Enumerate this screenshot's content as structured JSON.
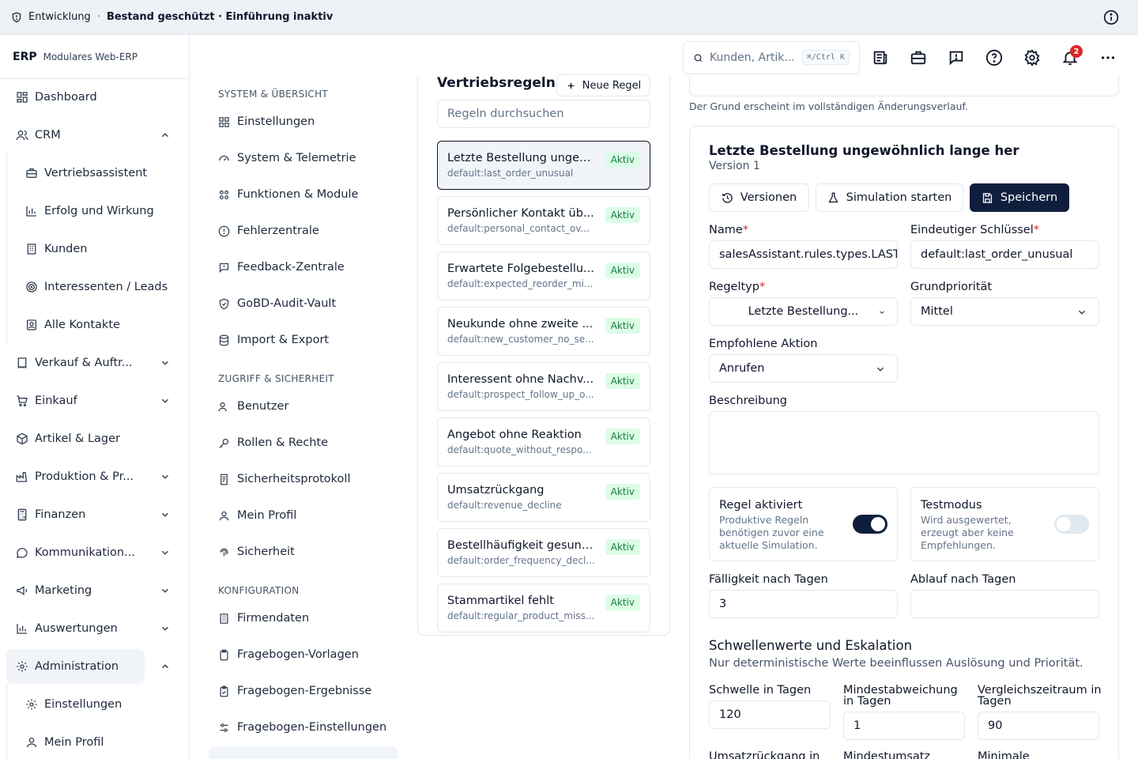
{
  "topbar": {
    "environment": "Entwicklung",
    "separator": "·",
    "status": "Bestand geschützt · Einführung inaktiv"
  },
  "brand": {
    "logo": "ERP",
    "subtitle": "Modulares Web-ERP"
  },
  "sidebar": {
    "items": [
      {
        "label": "Dashboard",
        "icon": "dashboard-icon"
      },
      {
        "label": "CRM",
        "icon": "users-icon",
        "expanded": true
      },
      {
        "label": "Vertriebsassistent",
        "icon": "briefcase-icon"
      },
      {
        "label": "Erfolg und Wirkung",
        "icon": "chart-icon"
      },
      {
        "label": "Kunden",
        "icon": "building-icon"
      },
      {
        "label": "Interessenten / Leads",
        "icon": "target-icon"
      },
      {
        "label": "Alle Kontakte",
        "icon": "contact-icon"
      },
      {
        "label": "Verkauf & Auftr...",
        "icon": "cart-icon"
      },
      {
        "label": "Einkauf",
        "icon": "cart-icon"
      },
      {
        "label": "Artikel & Lager",
        "icon": "box-icon"
      },
      {
        "label": "Produktion & Pr...",
        "icon": "factory-icon"
      },
      {
        "label": "Finanzen",
        "icon": "calculator-icon"
      },
      {
        "label": "Kommunikation...",
        "icon": "message-icon"
      },
      {
        "label": "Marketing",
        "icon": "megaphone-icon"
      },
      {
        "label": "Auswertungen",
        "icon": "chart-icon"
      },
      {
        "label": "Administration",
        "icon": "gear-icon",
        "active": true
      },
      {
        "label": "Einstellungen",
        "icon": "gear-icon"
      },
      {
        "label": "Mein Profil",
        "icon": "user-icon"
      }
    ]
  },
  "search": {
    "placeholder": "Kunden, Artik...",
    "shortcut": "⌘/Ctrl K"
  },
  "notifications": {
    "count": "2"
  },
  "settings_nav": {
    "section1": "SYSTEM & ÜBERSICHT",
    "section1_items": [
      "Einstellungen",
      "System & Telemetrie",
      "Funktionen & Module",
      "Fehlerzentrale",
      "Feedback-Zentrale",
      "GoBD-Audit-Vault",
      "Import & Export"
    ],
    "section2": "ZUGRIFF & SICHERHEIT",
    "section2_items": [
      "Benutzer",
      "Rollen & Rechte",
      "Sicherheitsprotokoll",
      "Mein Profil",
      "Sicherheit"
    ],
    "section3": "KONFIGURATION",
    "section3_items": [
      "Firmendaten",
      "Fragebogen-Vorlagen",
      "Fragebogen-Ergebnisse",
      "Fragebogen-Einstellungen"
    ]
  },
  "rules": {
    "title": "Vertriebsregeln",
    "new_button": "Neue Regel",
    "search_placeholder": "Regeln durchsuchen",
    "status_label": "Aktiv",
    "items": [
      {
        "name": "Letzte Bestellung ungew...",
        "key": "default:last_order_unusual"
      },
      {
        "name": "Persönlicher Kontakt üb...",
        "key": "default:personal_contact_ov..."
      },
      {
        "name": "Erwartete Folgebestellu...",
        "key": "default:expected_reorder_mi..."
      },
      {
        "name": "Neukunde ohne zweite ...",
        "key": "default:new_customer_no_se..."
      },
      {
        "name": "Interessent ohne Nachv...",
        "key": "default:prospect_follow_up_o..."
      },
      {
        "name": "Angebot ohne Reaktion",
        "key": "default:quote_without_respo..."
      },
      {
        "name": "Umsatzrückgang",
        "key": "default:revenue_decline"
      },
      {
        "name": "Bestellhäufigkeit gesunk...",
        "key": "default:order_frequency_decl..."
      },
      {
        "name": "Stammartikel fehlt",
        "key": "default:regular_product_miss..."
      }
    ]
  },
  "detail": {
    "reason_note": "Der Grund erscheint im vollständigen Änderungsverlauf.",
    "title": "Letzte Bestellung ungewöhnlich lange her",
    "version": "Version 1",
    "btn_versions": "Versionen",
    "btn_simulation": "Simulation starten",
    "btn_save": "Speichern",
    "name_label": "Name",
    "name_value": "salesAssistant.rules.types.LAST_ORDER_UNUSUAL",
    "key_label": "Eindeutiger Schlüssel",
    "key_value": "default:last_order_unusual",
    "type_label": "Regeltyp",
    "type_value": "Letzte Bestellung...",
    "priority_label": "Grundpriorität",
    "priority_value": "Mittel",
    "action_label": "Empfohlene Aktion",
    "action_value": "Anrufen",
    "description_label": "Beschreibung",
    "toggle_enabled_title": "Regel aktiviert",
    "toggle_enabled_desc": "Produktive Regeln benötigen zuvor eine aktuelle Simulation.",
    "toggle_enabled_on": true,
    "toggle_test_title": "Testmodus",
    "toggle_test_desc": "Wird ausgewertet, erzeugt aber keine Empfehlungen.",
    "toggle_test_on": false,
    "due_label": "Fälligkeit nach Tagen",
    "due_value": "3",
    "expiry_label": "Ablauf nach Tagen",
    "expiry_value": "",
    "thresholds_title": "Schwellenwerte und Eskalation",
    "thresholds_sub": "Nur deterministische Werte beeinflussen Auslösung und Priorität.",
    "threshold_days_label": "Schwelle in Tagen",
    "threshold_days_value": "120",
    "min_dev_label": "Mindestabweichung in Tagen",
    "min_dev_value": "1",
    "compare_label": "Vergleichszeitraum in Tagen",
    "compare_value": "90",
    "revenue_decline_label": "Umsatzrückgang in",
    "min_revenue_label": "Mindestumsatz",
    "minimal_label": "Minimale"
  },
  "colors": {
    "accent": "#0f1e3d",
    "active_green_bg": "#dcfce7",
    "active_green_text": "#15803d",
    "danger": "#dc2626"
  }
}
